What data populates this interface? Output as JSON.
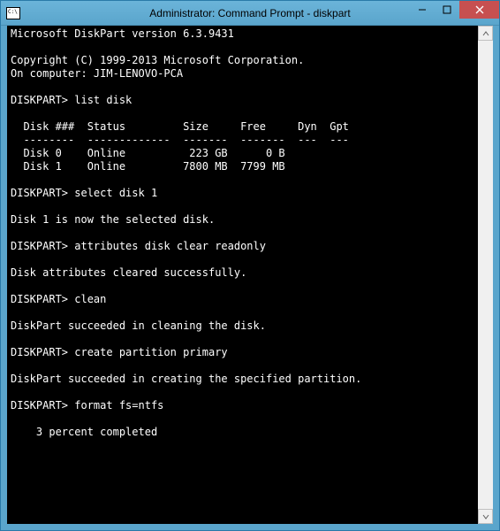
{
  "window": {
    "title": "Administrator: Command Prompt - diskpart"
  },
  "terminal": {
    "version_line": "Microsoft DiskPart version 6.3.9431",
    "blank": "",
    "copyright": "Copyright (C) 1999-2013 Microsoft Corporation.",
    "on_computer": "On computer: JIM-LENOVO-PCA",
    "prompt1": "DISKPART> list disk",
    "table_header": "  Disk ###  Status         Size     Free     Dyn  Gpt",
    "table_rule": "  --------  -------------  -------  -------  ---  ---",
    "disk0": "  Disk 0    Online          223 GB      0 B",
    "disk1": "  Disk 1    Online         7800 MB  7799 MB",
    "prompt2": "DISKPART> select disk 1",
    "resp2": "Disk 1 is now the selected disk.",
    "prompt3": "DISKPART> attributes disk clear readonly",
    "resp3": "Disk attributes cleared successfully.",
    "prompt4": "DISKPART> clean",
    "resp4": "DiskPart succeeded in cleaning the disk.",
    "prompt5": "DISKPART> create partition primary",
    "resp5": "DiskPart succeeded in creating the specified partition.",
    "prompt6": "DISKPART> format fs=ntfs",
    "progress": "    3 percent completed"
  }
}
